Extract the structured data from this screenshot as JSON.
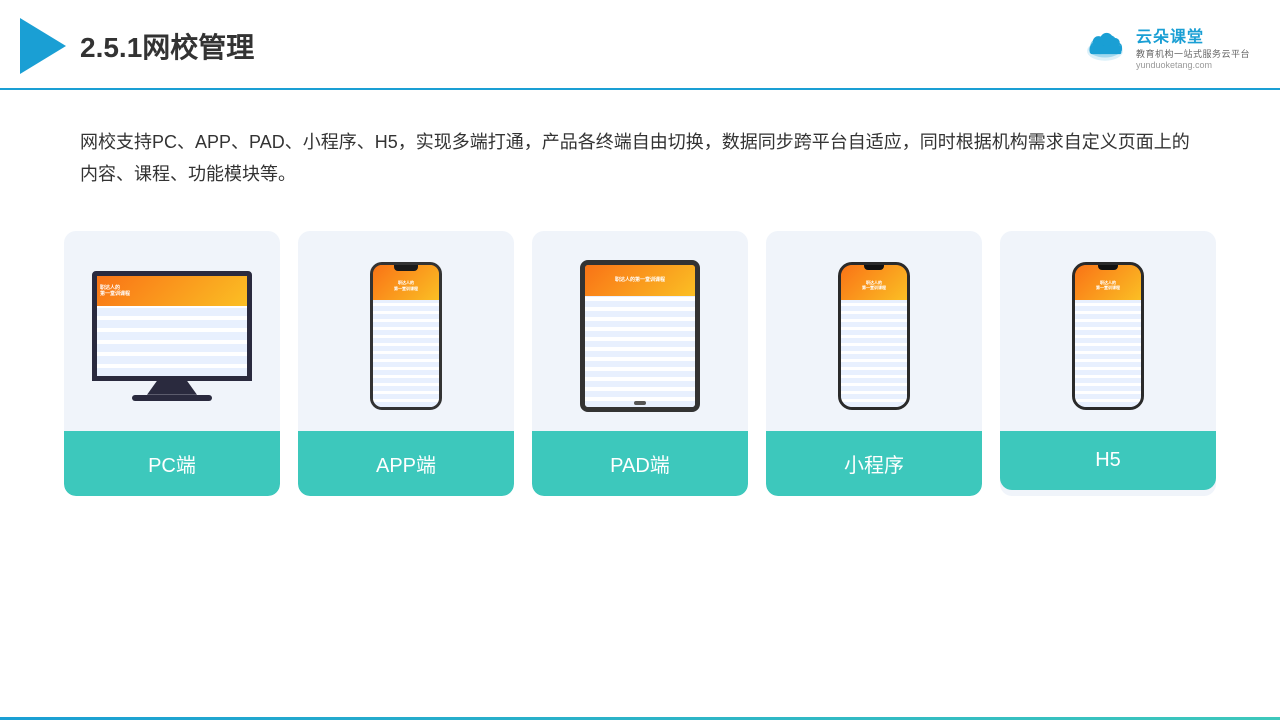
{
  "header": {
    "title": "2.5.1网校管理",
    "logo": {
      "main": "云朵课堂",
      "tagline": "教育机构一站式服务云平台",
      "url": "yunduoketang.com"
    }
  },
  "description": "网校支持PC、APP、PAD、小程序、H5，实现多端打通，产品各终端自由切换，数据同步跨平台自适应，同时根据机构需求自定义页面上的内容、课程、功能模块等。",
  "cards": [
    {
      "id": "pc",
      "label": "PC端"
    },
    {
      "id": "app",
      "label": "APP端"
    },
    {
      "id": "pad",
      "label": "PAD端"
    },
    {
      "id": "miniprogram",
      "label": "小程序"
    },
    {
      "id": "h5",
      "label": "H5"
    }
  ],
  "colors": {
    "accent_blue": "#1a9fd4",
    "accent_teal": "#3dc8bc",
    "card_bg": "#f0f4fa"
  }
}
